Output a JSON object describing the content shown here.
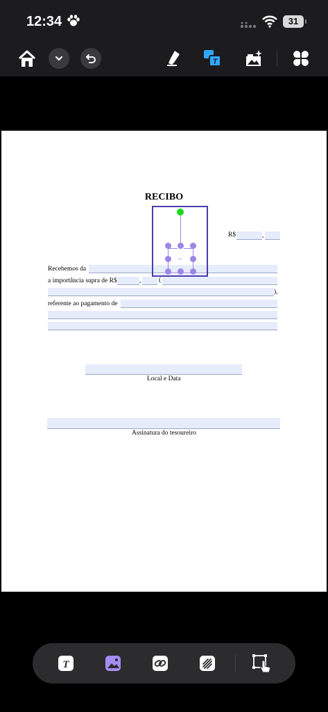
{
  "status_bar": {
    "time": "12:34",
    "battery": "31"
  },
  "document": {
    "title": "RECIBO",
    "currency_label": "R$",
    "currency_dot": ",",
    "received_from_label": "Recebemos da",
    "amount_label": "a importância supra de R$",
    "amount_dot": ",",
    "amount_paren_open": "(",
    "amount_paren_close": "),",
    "reference_label": "referente ao pagamento de",
    "place_date_label": "Local e Data",
    "signature_label": "Assinatura do tesoureiro",
    "inserted_image_text": "..."
  },
  "colors": {
    "field_fill": "#e6ecfa",
    "selection": "#4a3bb0",
    "handle": "#9b86e8",
    "rotate_handle": "#1ed81e"
  }
}
